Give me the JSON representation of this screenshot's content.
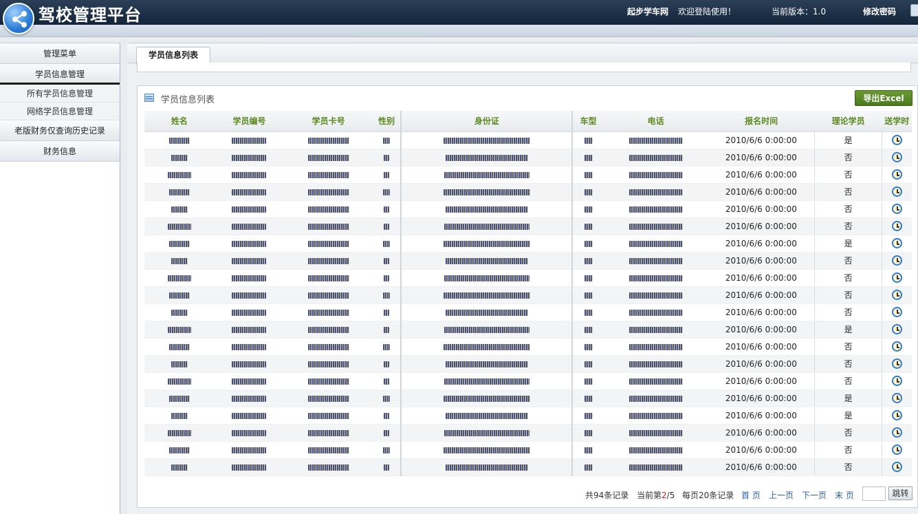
{
  "header": {
    "title": "驾校管理平台",
    "site_name": "起步学车网",
    "welcome": "欢迎登陆使用！",
    "version": "当前版本：1.0",
    "change_password": "修改密码"
  },
  "sidebar": {
    "menu_title": "管理菜单",
    "section_student": "学员信息管理",
    "sub_all": "所有学员信息管理",
    "sub_online": "网络学员信息管理",
    "section_finance_old": "老版财务仅查询历史记录",
    "section_finance": "财务信息"
  },
  "main": {
    "tab_label": "学员信息列表",
    "panel_title": "学员信息列表",
    "export_label": "导出Excel",
    "columns": [
      "姓名",
      "学员编号",
      "学员卡号",
      "性别",
      "身份证",
      "车型",
      "电话",
      "报名时间",
      "理论学员",
      "送学时"
    ],
    "rows": [
      {
        "date": "2010/6/6 0:00:00",
        "theory": "是"
      },
      {
        "date": "2010/6/6 0:00:00",
        "theory": "否"
      },
      {
        "date": "2010/6/6 0:00:00",
        "theory": "否"
      },
      {
        "date": "2010/6/6 0:00:00",
        "theory": "否"
      },
      {
        "date": "2010/6/6 0:00:00",
        "theory": "否"
      },
      {
        "date": "2010/6/6 0:00:00",
        "theory": "否"
      },
      {
        "date": "2010/6/6 0:00:00",
        "theory": "是"
      },
      {
        "date": "2010/6/6 0:00:00",
        "theory": "否"
      },
      {
        "date": "2010/6/6 0:00:00",
        "theory": "否"
      },
      {
        "date": "2010/6/6 0:00:00",
        "theory": "否"
      },
      {
        "date": "2010/6/6 0:00:00",
        "theory": "否"
      },
      {
        "date": "2010/6/6 0:00:00",
        "theory": "是"
      },
      {
        "date": "2010/6/6 0:00:00",
        "theory": "否"
      },
      {
        "date": "2010/6/6 0:00:00",
        "theory": "否"
      },
      {
        "date": "2010/6/6 0:00:00",
        "theory": "否"
      },
      {
        "date": "2010/6/6 0:00:00",
        "theory": "是"
      },
      {
        "date": "2010/6/6 0:00:00",
        "theory": "是"
      },
      {
        "date": "2010/6/6 0:00:00",
        "theory": "否"
      },
      {
        "date": "2010/6/6 0:00:00",
        "theory": "否"
      },
      {
        "date": "2010/6/6 0:00:00",
        "theory": "否"
      }
    ]
  },
  "pager": {
    "total": "共94条记录",
    "current_prefix": "当前第",
    "current_page": "2",
    "current_suffix": "/5",
    "per_page": "每页20条记录",
    "first": "首 页",
    "prev": "上一页",
    "next": "下一页",
    "last": "末 页",
    "go": "跳转"
  },
  "colors": {
    "header_bg": "#13253a",
    "column_header_text": "#5b8a23",
    "export_button": "#4a7a1e",
    "yes_text": "#dd2222",
    "link": "#2a5ea8"
  },
  "icons": [
    "logo-share-icon",
    "list-icon",
    "alarm-clock-icon"
  ]
}
